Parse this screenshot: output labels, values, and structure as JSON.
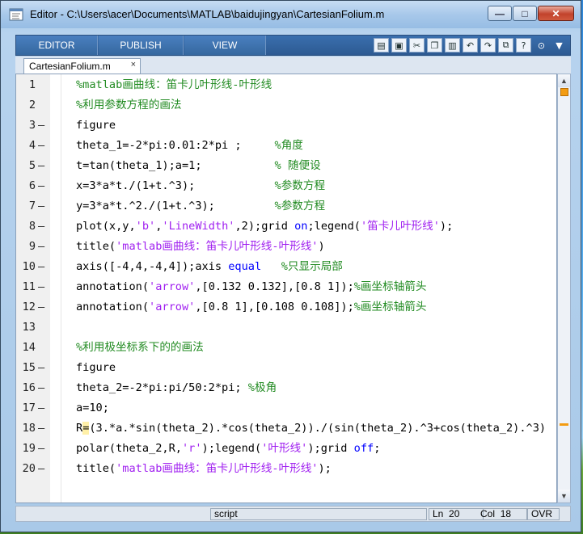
{
  "window": {
    "title": "Editor - C:\\Users\\acer\\Documents\\MATLAB\\baidujingyan\\CartesianFolium.m",
    "minimize_label": "—",
    "maximize_label": "□",
    "close_label": "✕"
  },
  "toolstrip": {
    "tabs": [
      {
        "label": "EDITOR"
      },
      {
        "label": "PUBLISH"
      },
      {
        "label": "VIEW"
      }
    ],
    "quick_access_icons": [
      "new-file-icon",
      "save-icon",
      "cut-icon",
      "copy-icon",
      "paste-icon",
      "undo-icon",
      "redo-icon",
      "switch-windows-icon",
      "help-icon",
      "dropdown-icon",
      "minimize-toolstrip-icon"
    ]
  },
  "document_tab": {
    "label": "CartesianFolium.m",
    "close_label": "×"
  },
  "editor": {
    "lines": [
      {
        "num": "1",
        "dash": "",
        "code": "%matlab画曲线：笛卡儿叶形线-叶形线"
      },
      {
        "num": "2",
        "dash": "",
        "code": "%利用参数方程的画法"
      },
      {
        "num": "3",
        "dash": "—",
        "code": "figure"
      },
      {
        "num": "4",
        "dash": "—",
        "code": "theta_1=-2*pi:0.01:2*pi ;     %角度"
      },
      {
        "num": "5",
        "dash": "—",
        "code": "t=tan(theta_1);a=1;           % 随便设"
      },
      {
        "num": "6",
        "dash": "—",
        "code": "x=3*a*t./(1+t.^3);            %参数方程"
      },
      {
        "num": "7",
        "dash": "—",
        "code": "y=3*a*t.^2./(1+t.^3);         %参数方程"
      },
      {
        "num": "8",
        "dash": "—",
        "code": "plot(x,y,'b','LineWidth',2);grid on;legend('笛卡儿叶形线');"
      },
      {
        "num": "9",
        "dash": "—",
        "code": "title('matlab画曲线：笛卡儿叶形线-叶形线')"
      },
      {
        "num": "10",
        "dash": "—",
        "code": "axis([-4,4,-4,4]);axis equal   %只显示局部"
      },
      {
        "num": "11",
        "dash": "—",
        "code": "annotation('arrow',[0.132 0.132],[0.8 1]);%画坐标轴箭头"
      },
      {
        "num": "12",
        "dash": "—",
        "code": "annotation('arrow',[0.8 1],[0.108 0.108]);%画坐标轴箭头"
      },
      {
        "num": "13",
        "dash": "",
        "code": ""
      },
      {
        "num": "14",
        "dash": "",
        "code": "%利用极坐标系下的的画法"
      },
      {
        "num": "15",
        "dash": "—",
        "code": "figure"
      },
      {
        "num": "16",
        "dash": "—",
        "code": "theta_2=-2*pi:pi/50:2*pi; %极角"
      },
      {
        "num": "17",
        "dash": "—",
        "code": "a=10;"
      },
      {
        "num": "18",
        "dash": "—",
        "code": "R=(3.*a.*sin(theta_2).*cos(theta_2))./(sin(theta_2).^3+cos(theta_2).^3)"
      },
      {
        "num": "19",
        "dash": "—",
        "code": "polar(theta_2,R,'r');legend('叶形线');grid off;"
      },
      {
        "num": "20",
        "dash": "—",
        "code": "title('matlab画曲线：笛卡儿叶形线-叶形线');"
      }
    ]
  },
  "statusbar": {
    "mode": "script",
    "ln_label": "Ln",
    "ln_value": "20",
    "col_label": "Col",
    "col_value": "18",
    "ovr_label": "OVR"
  },
  "colors": {
    "comment": "#228b22",
    "keyword": "#0000ff",
    "string": "#a020f0",
    "toolstrip": "#2d5a92",
    "warning_mark": "#f39c12"
  }
}
